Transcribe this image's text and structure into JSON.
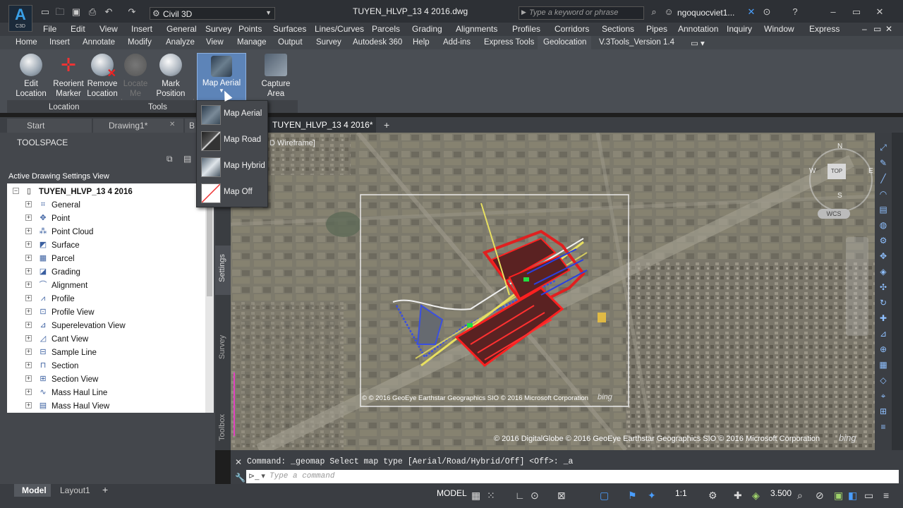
{
  "titlebar": {
    "app_badge": "A",
    "app_sub": "C3D",
    "workspace": "Civil 3D",
    "doc_title": "TUYEN_HLVP_13 4 2016.dwg",
    "search_placeholder": "Type a keyword or phrase",
    "user": "ngoquocviet1..."
  },
  "menu": [
    "File",
    "Edit",
    "View",
    "Insert",
    "General",
    "Survey",
    "Points",
    "Surfaces",
    "Lines/Curves",
    "Parcels",
    "Grading",
    "Alignments",
    "Profiles",
    "Corridors",
    "Sections",
    "Pipes",
    "Annotation",
    "Inquiry",
    "Window",
    "Express"
  ],
  "ribbon_tabs": [
    "Home",
    "Insert",
    "Annotate",
    "Modify",
    "Analyze",
    "View",
    "Manage",
    "Output",
    "Survey",
    "Autodesk 360",
    "Help",
    "Add-ins",
    "Express Tools",
    "Geolocation",
    "V.3Tools_Version 1.4"
  ],
  "ribbon": {
    "edit_location": [
      "Edit",
      "Location"
    ],
    "reorient_marker": [
      "Reorient",
      "Marker"
    ],
    "remove_location": [
      "Remove",
      "Location"
    ],
    "locate_me": [
      "Locate",
      "Me"
    ],
    "mark_position": [
      "Mark",
      "Position"
    ],
    "map_aerial": "Map Aerial",
    "capture_area": [
      "Capture",
      "Area"
    ],
    "panel_location": "Location",
    "panel_tools": "Tools"
  },
  "dropdown": [
    {
      "label": "Map Aerial"
    },
    {
      "label": "Map Road"
    },
    {
      "label": "Map Hybrid"
    },
    {
      "label": "Map Off"
    }
  ],
  "doc_tabs": {
    "start": "Start",
    "drawing1": "Drawing1*",
    "b": "B",
    "active": "TUYEN_HLVP_13 4 2016*",
    "plus": "+"
  },
  "toolspace": {
    "title": "TOOLSPACE",
    "view_label": "Active Drawing Settings View",
    "root": "TUYEN_HLVP_13 4 2016",
    "items": [
      "General",
      "Point",
      "Point Cloud",
      "Surface",
      "Parcel",
      "Grading",
      "Alignment",
      "Profile",
      "Profile View",
      "Superelevation View",
      "Cant View",
      "Sample Line",
      "Section",
      "Section View",
      "Mass Haul Line",
      "Mass Haul View"
    ],
    "side_tabs": [
      "Settings",
      "Survey",
      "Toolbox"
    ]
  },
  "viewport": {
    "view_label": "D Wireframe]",
    "viewcube": {
      "n": "N",
      "s": "S",
      "e": "E",
      "w": "W",
      "top": "TOP",
      "wcs": "WCS"
    },
    "copyright_inner": "© © 2016 GeoEye Earthstar Geographics SIO © 2016 Microsoft Corporation",
    "copyright_outer": "© 2016 DigitalGlobe © 2016 GeoEye Earthstar Geographics SIO © 2016 Microsoft Corporation",
    "bing": "bing"
  },
  "command": {
    "history": "Command: _geomap Select map type [Aerial/Road/Hybrid/Off] <Off>: _a",
    "placeholder": "Type a command"
  },
  "status": {
    "model_tab": "Model",
    "layout_tab": "Layout1",
    "plus": "+",
    "model": "MODEL",
    "scale": "1:1",
    "lineweight": "3.500"
  }
}
